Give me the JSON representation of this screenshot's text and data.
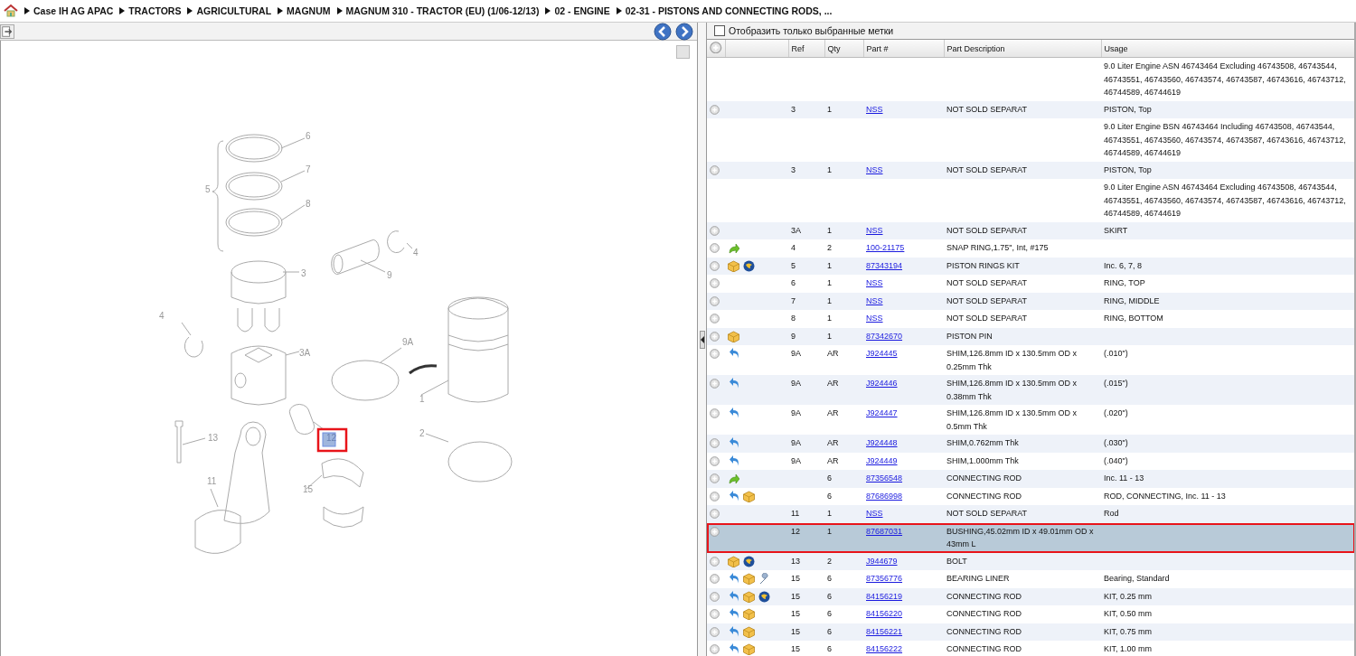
{
  "breadcrumb": [
    "Case IH AG APAC",
    "TRACTORS",
    "AGRICULTURAL",
    "MAGNUM",
    "MAGNUM 310 - TRACTOR (EU) (1/06-12/13)",
    "02 - ENGINE",
    "02-31 - PISTONS AND CONNECTING RODS, ..."
  ],
  "diagram": {
    "callouts": [
      {
        "label": "6",
        "selected": false
      },
      {
        "label": "7",
        "selected": false
      },
      {
        "label": "8",
        "selected": false
      },
      {
        "label": "5",
        "selected": false
      },
      {
        "label": "4",
        "selected": false
      },
      {
        "label": "9",
        "selected": false
      },
      {
        "label": "3",
        "selected": false
      },
      {
        "label": "4",
        "selected": false
      },
      {
        "label": "3A",
        "selected": false
      },
      {
        "label": "9A",
        "selected": false
      },
      {
        "label": "1",
        "selected": false
      },
      {
        "label": "13",
        "selected": false
      },
      {
        "label": "12",
        "selected": true
      },
      {
        "label": "2",
        "selected": false
      },
      {
        "label": "11",
        "selected": false
      },
      {
        "label": "15",
        "selected": false
      }
    ]
  },
  "filter": {
    "label": "Отобразить только выбранные метки",
    "checked": false
  },
  "table": {
    "columns": [
      "Ref",
      "Qty",
      "Part #",
      "Part Description",
      "Usage"
    ],
    "rows": [
      {
        "kind": "note",
        "usage": "9.0 Liter Engine ASN 46743464 Excluding 46743508, 46743544, 46743551, 46743560, 46743574, 46743587, 46743616, 46743712, 46744589, 46744619"
      },
      {
        "kind": "part",
        "ref": "3",
        "qty": "1",
        "part": "NSS",
        "description": "NOT SOLD SEPARAT",
        "usage": "PISTON, Top",
        "selected": false
      },
      {
        "kind": "note",
        "usage": "9.0 Liter Engine BSN 46743464 Including 46743508, 46743544, 46743551, 46743560, 46743574, 46743587, 46743616, 46743712, 46744589, 46744619"
      },
      {
        "kind": "part",
        "ref": "3",
        "qty": "1",
        "part": "NSS",
        "description": "NOT SOLD SEPARAT",
        "usage": "PISTON, Top",
        "selected": false
      },
      {
        "kind": "note",
        "usage": "9.0 Liter Engine ASN 46743464 Excluding 46743508, 46743544, 46743551, 46743560, 46743574, 46743587, 46743616, 46743712, 46744589, 46744619"
      },
      {
        "kind": "part",
        "ref": "3A",
        "qty": "1",
        "part": "NSS",
        "description": "NOT SOLD SEPARAT",
        "usage": "SKIRT",
        "selected": false
      },
      {
        "kind": "part",
        "icons": [
          {
            "kind": "forward"
          }
        ],
        "ref": "4",
        "qty": "2",
        "part": "100-21175",
        "description": "SNAP RING,1.75\", Int, #175",
        "selected": false
      },
      {
        "kind": "part",
        "icons": [
          {
            "kind": "box"
          },
          {
            "kind": "globe"
          }
        ],
        "ref": "5",
        "qty": "1",
        "part": "87343194",
        "description": "PISTON RINGS KIT",
        "usage": "Inc. 6, 7, 8",
        "selected": false
      },
      {
        "kind": "part",
        "ref": "6",
        "qty": "1",
        "part": "NSS",
        "description": "NOT SOLD SEPARAT",
        "usage": "RING, TOP",
        "selected": false
      },
      {
        "kind": "part",
        "ref": "7",
        "qty": "1",
        "part": "NSS",
        "description": "NOT SOLD SEPARAT",
        "usage": "RING, MIDDLE",
        "selected": false
      },
      {
        "kind": "part",
        "ref": "8",
        "qty": "1",
        "part": "NSS",
        "description": "NOT SOLD SEPARAT",
        "usage": "RING, BOTTOM",
        "selected": false
      },
      {
        "kind": "part",
        "icons": [
          {
            "kind": "box"
          }
        ],
        "ref": "9",
        "qty": "1",
        "part": "87342670",
        "description": "PISTON PIN",
        "selected": false
      },
      {
        "kind": "part",
        "icons": [
          {
            "kind": "back"
          }
        ],
        "ref": "9A",
        "qty": "AR",
        "part": "J924445",
        "description": "SHIM,126.8mm ID x 130.5mm OD x 0.25mm Thk",
        "usage": "(.010\")",
        "selected": false
      },
      {
        "kind": "part",
        "icons": [
          {
            "kind": "back"
          }
        ],
        "ref": "9A",
        "qty": "AR",
        "part": "J924446",
        "description": "SHIM,126.8mm ID x 130.5mm OD x 0.38mm Thk",
        "usage": "(.015\")",
        "selected": false
      },
      {
        "kind": "part",
        "icons": [
          {
            "kind": "back"
          }
        ],
        "ref": "9A",
        "qty": "AR",
        "part": "J924447",
        "description": "SHIM,126.8mm ID x 130.5mm OD x 0.5mm Thk",
        "usage": "(.020\")",
        "selected": false
      },
      {
        "kind": "part",
        "icons": [
          {
            "kind": "back"
          }
        ],
        "ref": "9A",
        "qty": "AR",
        "part": "J924448",
        "description": "SHIM,0.762mm Thk",
        "usage": "(.030\")",
        "selected": false
      },
      {
        "kind": "part",
        "icons": [
          {
            "kind": "back"
          }
        ],
        "ref": "9A",
        "qty": "AR",
        "part": "J924449",
        "description": "SHIM,1.000mm Thk",
        "usage": "(.040\")",
        "selected": false
      },
      {
        "kind": "part",
        "icons": [
          {
            "kind": "forward"
          }
        ],
        "qty": "6",
        "part": "87356548",
        "description": "CONNECTING ROD",
        "usage": "Inc. 11 - 13",
        "selected": false
      },
      {
        "kind": "part",
        "icons": [
          {
            "kind": "back"
          },
          {
            "kind": "box"
          }
        ],
        "qty": "6",
        "part": "87686998",
        "description": "CONNECTING ROD",
        "usage": "ROD, CONNECTING, Inc. 11 - 13",
        "selected": false
      },
      {
        "kind": "part",
        "ref": "11",
        "qty": "1",
        "part": "NSS",
        "description": "NOT SOLD SEPARAT",
        "usage": "Rod",
        "selected": false
      },
      {
        "kind": "part",
        "ref": "12",
        "qty": "1",
        "part": "87687031",
        "description": "BUSHING,45.02mm ID x 49.01mm OD x 43mm L",
        "selected": true
      },
      {
        "kind": "part",
        "icons": [
          {
            "kind": "box"
          },
          {
            "kind": "globe"
          }
        ],
        "ref": "13",
        "qty": "2",
        "part": "J944679",
        "description": "BOLT",
        "selected": false
      },
      {
        "kind": "part",
        "icons": [
          {
            "kind": "back"
          },
          {
            "kind": "box"
          },
          {
            "kind": "wrench"
          }
        ],
        "ref": "15",
        "qty": "6",
        "part": "87356776",
        "description": "BEARING LINER",
        "usage": "Bearing, Standard",
        "selected": false
      },
      {
        "kind": "part",
        "icons": [
          {
            "kind": "back"
          },
          {
            "kind": "box"
          },
          {
            "kind": "globe"
          }
        ],
        "ref": "15",
        "qty": "6",
        "part": "84156219",
        "description": "CONNECTING ROD",
        "usage": "KIT, 0.25 mm",
        "selected": false
      },
      {
        "kind": "part",
        "icons": [
          {
            "kind": "back"
          },
          {
            "kind": "box"
          }
        ],
        "ref": "15",
        "qty": "6",
        "part": "84156220",
        "description": "CONNECTING ROD",
        "usage": "KIT, 0.50 mm",
        "selected": false
      },
      {
        "kind": "part",
        "icons": [
          {
            "kind": "back"
          },
          {
            "kind": "box"
          }
        ],
        "ref": "15",
        "qty": "6",
        "part": "84156221",
        "description": "CONNECTING ROD",
        "usage": "KIT, 0.75 mm",
        "selected": false
      },
      {
        "kind": "part",
        "icons": [
          {
            "kind": "back"
          },
          {
            "kind": "box"
          }
        ],
        "ref": "15",
        "qty": "6",
        "part": "84156222",
        "description": "CONNECTING ROD",
        "usage": "KIT, 1.00 mm",
        "selected": false
      }
    ]
  }
}
